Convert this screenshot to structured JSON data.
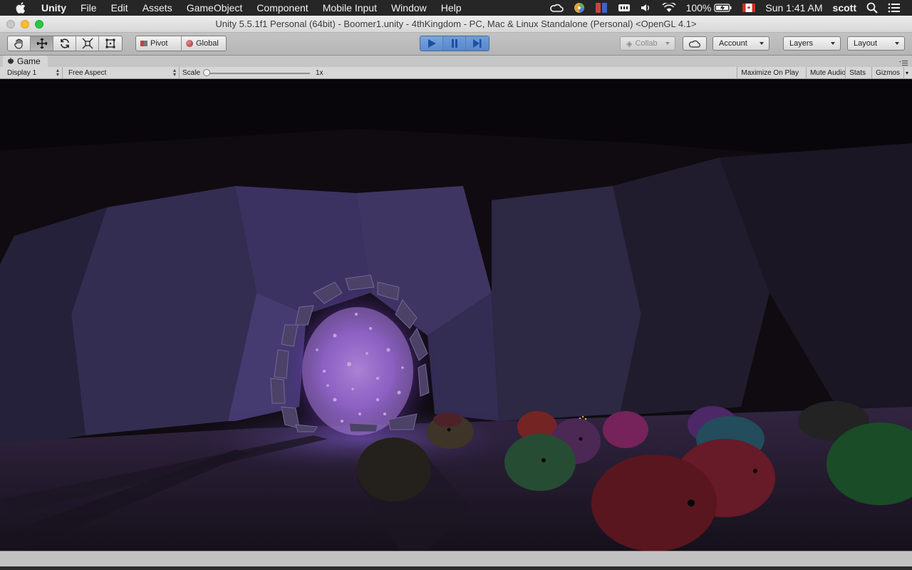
{
  "menubar": {
    "app_name": "Unity",
    "items": [
      "File",
      "Edit",
      "Assets",
      "GameObject",
      "Component",
      "Mobile Input",
      "Window",
      "Help"
    ],
    "battery": "100%",
    "datetime": "Sun 1:41 AM",
    "user": "scott"
  },
  "window": {
    "title": "Unity 5.5.1f1 Personal (64bit) - Boomer1.unity - 4thKingdom - PC, Mac & Linux Standalone (Personal) <OpenGL 4.1>"
  },
  "toolbar": {
    "pivot_label": "Pivot",
    "global_label": "Global",
    "collab_label": "Collab",
    "account_label": "Account",
    "layers_label": "Layers",
    "layout_label": "Layout",
    "play_state": "playing"
  },
  "game_panel": {
    "tab_label": "Game",
    "display_label": "Display 1",
    "aspect_label": "Free Aspect",
    "scale_label": "Scale",
    "scale_value": "1x",
    "maximize_label": "Maximize On Play",
    "mute_label": "Mute Audio",
    "stats_label": "Stats",
    "gizmos_label": "Gizmos"
  },
  "colors": {
    "portal_glow": "#b07cff",
    "play_active": "#5b8bd0"
  }
}
